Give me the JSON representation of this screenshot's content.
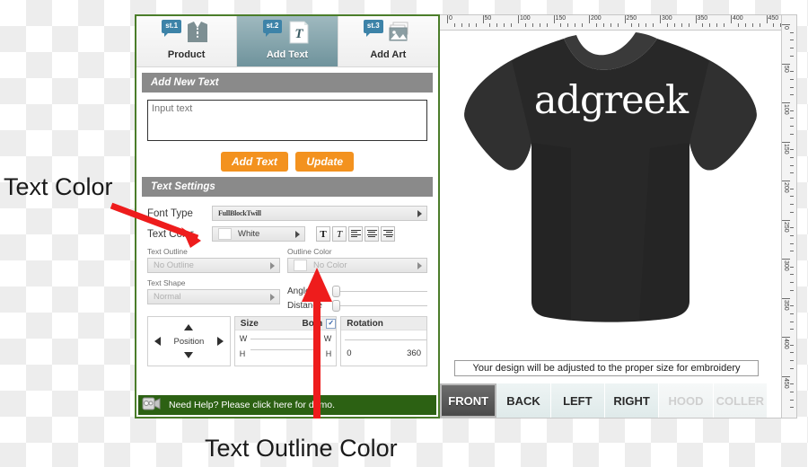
{
  "annotations": {
    "text_color": "Text Color",
    "text_outline_color": "Text Outline Color",
    "arrow_color": "#ee1c1c"
  },
  "designer": {
    "accent_border": "#4b7d2a",
    "steps": [
      {
        "badge": "st.1",
        "label": "Product",
        "icon": "shirt-icon",
        "active": false
      },
      {
        "badge": "st.2",
        "label": "Add Text",
        "icon": "text-document-icon",
        "active": true
      },
      {
        "badge": "st.3",
        "label": "Add Art",
        "icon": "image-stack-icon",
        "active": false
      }
    ],
    "add_new_text": {
      "title": "Add New Text",
      "input_placeholder": "Input text",
      "input_value": "",
      "add_button": "Add Text",
      "update_button": "Update",
      "button_color": "#f3921f"
    },
    "text_settings": {
      "title": "Text Settings",
      "font_type": {
        "label": "Font Type",
        "value": "FullBlockTwill"
      },
      "text_color": {
        "label": "Text Color",
        "value": "White",
        "swatch": "#ffffff"
      },
      "style_buttons": [
        {
          "name": "bold",
          "glyph": "T"
        },
        {
          "name": "italic",
          "glyph": "T"
        },
        {
          "name": "align-left",
          "glyph": ""
        },
        {
          "name": "align-center",
          "glyph": ""
        },
        {
          "name": "align-right",
          "glyph": ""
        }
      ],
      "text_outline": {
        "label": "Text Outline",
        "value": "No Outline",
        "disabled": true
      },
      "outline_color": {
        "label": "Outline Color",
        "value": "No Color",
        "swatch": "#ffffff",
        "disabled": true
      },
      "text_shape": {
        "label": "Text Shape",
        "value": "Normal",
        "disabled": true
      },
      "angle": {
        "label": "Angle",
        "value": 0
      },
      "distance": {
        "label": "Distance",
        "value": 0
      }
    },
    "controls": {
      "position": {
        "label": "Position"
      },
      "size": {
        "title": "Size",
        "both_label": "Both",
        "both_checked": true,
        "w_label": "W",
        "h_label": "H"
      },
      "rotation": {
        "title": "Rotation",
        "min": "0",
        "max": "360"
      }
    },
    "help_bar": {
      "text": "Need Help? Please click here for demo.",
      "background": "#2c6113",
      "icon": "video-camera-icon"
    }
  },
  "preview": {
    "ruler_h_labels": [
      "0",
      "50",
      "100",
      "150",
      "200",
      "250",
      "300",
      "350",
      "400",
      "450"
    ],
    "ruler_v_labels": [
      "0",
      "50",
      "100",
      "150",
      "200",
      "250",
      "300",
      "350",
      "400",
      "450"
    ],
    "shirt": {
      "color": "#2a2a2a",
      "print_text": "adgreek",
      "print_color": "#ffffff"
    },
    "note": "Your design will be adjusted to the proper size for embroidery",
    "view_tabs": [
      {
        "label": "FRONT",
        "active": true,
        "disabled": false
      },
      {
        "label": "BACK",
        "active": false,
        "disabled": false
      },
      {
        "label": "LEFT",
        "active": false,
        "disabled": false
      },
      {
        "label": "RIGHT",
        "active": false,
        "disabled": false
      },
      {
        "label": "HOOD",
        "active": false,
        "disabled": true
      },
      {
        "label": "COLLER",
        "active": false,
        "disabled": true
      }
    ]
  }
}
